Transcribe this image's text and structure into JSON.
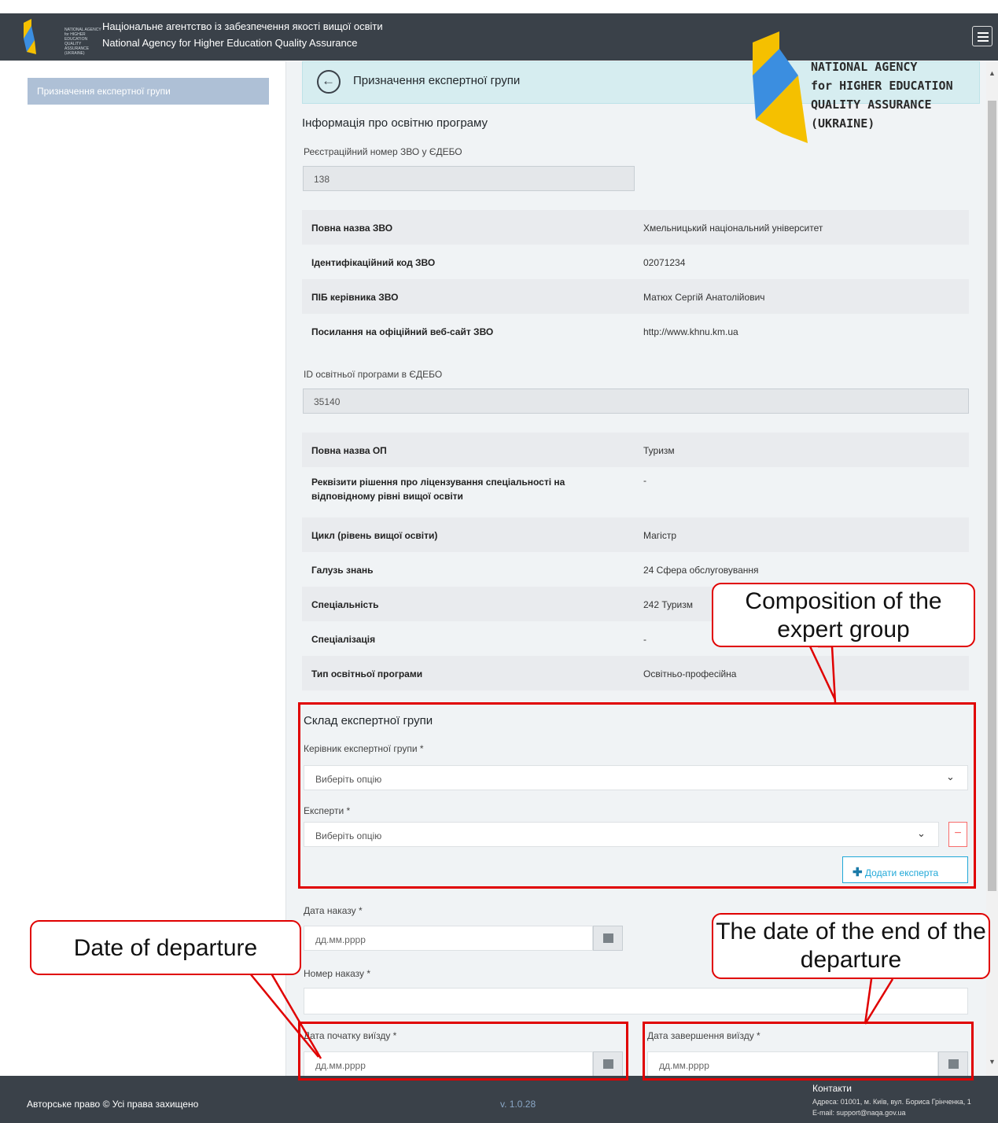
{
  "header": {
    "logo_text": "NATIONAL AGENCY for HIGHER EDUCATION QUALITY ASSURANCE (UKRAINE)",
    "title_ua": "Національне агентство із забезпечення якості вищої освіти",
    "title_en": "National Agency for Higher Education Quality Assurance",
    "menu_icon": "hamburger-icon"
  },
  "sidebar": {
    "items": [
      {
        "label": "Призначення експертної групи"
      }
    ]
  },
  "breadcrumb": {
    "back_icon": "arrow-left-circle-icon",
    "title": "Призначення експертної групи"
  },
  "brand_logo": {
    "lines": [
      "NATIONAL AGENCY",
      "for HIGHER EDUCATION",
      "QUALITY ASSURANCE",
      "(UKRAINE)"
    ],
    "colors": {
      "blue": "#3b8ee0",
      "yellow": "#f5c000"
    }
  },
  "program_info": {
    "section_title": "Інформація про освітню програму",
    "reg_number_label": "Реєстраційний номер ЗВО у ЄДЕБО",
    "reg_number_value": "138",
    "institution_rows": [
      {
        "key": "Повна назва ЗВО",
        "value": "Хмельницький національний університет"
      },
      {
        "key": "Ідентифікаційний код ЗВО",
        "value": "02071234"
      },
      {
        "key": "ПІБ керівника ЗВО",
        "value": "Матюх Сергій Анатолійович"
      },
      {
        "key": "Посилання на офіційний веб-сайт ЗВО",
        "value": "http://www.khnu.km.ua"
      }
    ],
    "program_id_label": "ID освітньої програми в ЄДЕБО",
    "program_id_value": "35140",
    "program_rows": [
      {
        "key": "Повна назва ОП",
        "value": "Туризм"
      },
      {
        "key": "Реквізити рішення про ліцензування спеціальності на відповідному рівні вищої освіти",
        "value": "-"
      },
      {
        "key": "Цикл (рівень вищої освіти)",
        "value": "Магістр"
      },
      {
        "key": "Галузь знань",
        "value": "24 Сфера обслуговування"
      },
      {
        "key": "Спеціальність",
        "value": "242 Туризм"
      },
      {
        "key": "Спеціалізація",
        "value": "-"
      },
      {
        "key": "Тип освітньої програми",
        "value": "Освітньо-професійна"
      }
    ]
  },
  "expert_group": {
    "section_title": "Склад експертної групи",
    "leader_label": "Керівник експертної групи *",
    "leader_value": "Виберіть опцію",
    "experts_label": "Експерти *",
    "experts_value": "Виберіть опцію",
    "remove_label": "−",
    "add_label": "Додати експерта"
  },
  "order": {
    "date_label": "Дата наказу *",
    "date_placeholder": "дд.мм.рррр",
    "number_label": "Номер наказу *",
    "number_value": ""
  },
  "visit": {
    "start_label": "Дата початку виїзду *",
    "start_placeholder": "дд.мм.рррр",
    "end_label": "Дата завершення виїзду *",
    "end_placeholder": "дд.мм.рррр"
  },
  "annotations": {
    "composition": "Composition of the expert group",
    "departure": "Date of departure",
    "end_departure": "The date of the end of the departure",
    "color": "#e00000"
  },
  "footer": {
    "copyright": "Авторське право © Усі права захищено",
    "version": "v. 1.0.28",
    "contacts_title": "Контакти",
    "address": "Адреса: 01001, м. Київ, вул. Бориса Грінченка, 1",
    "email": "E-mail: support@naqa.gov.ua"
  }
}
